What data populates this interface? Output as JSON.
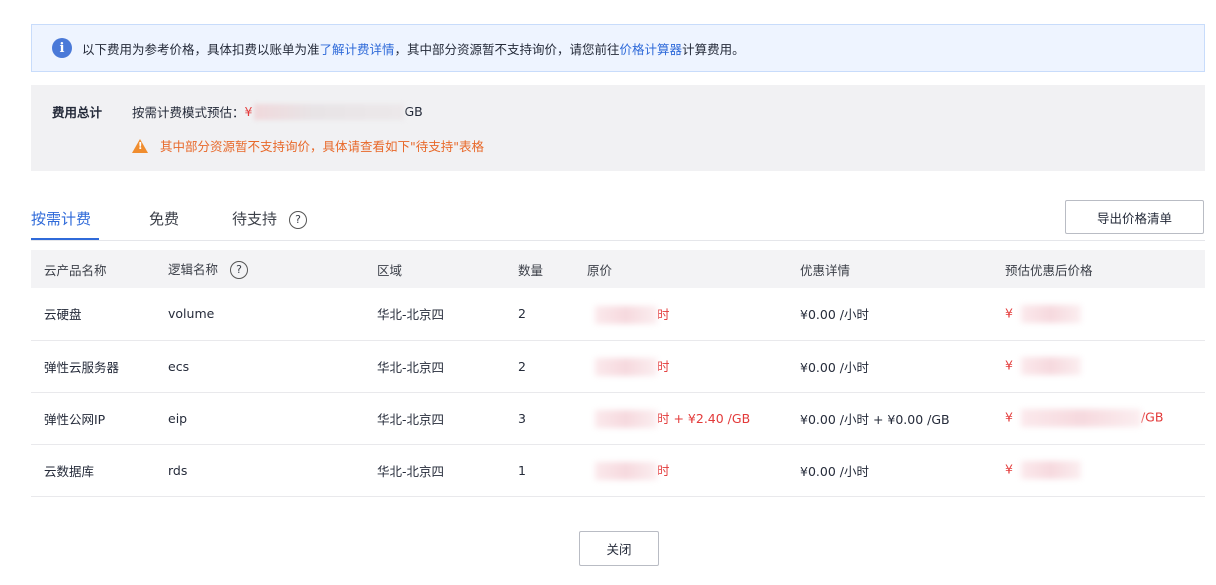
{
  "notice": {
    "text_prefix": "以下费用为参考价格，具体扣费以账单为准",
    "link_billing": "了解计费详情",
    "text_middle": "，其中部分资源暂不支持询价，请您前往",
    "link_calculator": "价格计算器",
    "text_suffix": "计算费用。"
  },
  "summary": {
    "label": "费用总计",
    "mode_label": "按需计费模式预估：",
    "currency": "¥",
    "unit_suffix": "GB",
    "warning": "其中部分资源暂不支持询价，具体请查看如下\"待支持\"表格"
  },
  "tabs": [
    {
      "label": "按需计费",
      "active": true
    },
    {
      "label": "免费",
      "active": false
    },
    {
      "label": "待支持",
      "active": false
    }
  ],
  "export_button": "导出价格清单",
  "table": {
    "headers": [
      "云产品名称",
      "逻辑名称",
      "区域",
      "数量",
      "原价",
      "优惠详情",
      "预估优惠后价格"
    ],
    "rows": [
      {
        "product": "云硬盘",
        "logical": "volume",
        "region": "华北-北京四",
        "qty": "2",
        "orig_suffix": "时",
        "discount": "¥0.00 /小时",
        "final_prefix": "¥",
        "final_suffix": ""
      },
      {
        "product": "弹性云服务器",
        "logical": "ecs",
        "region": "华北-北京四",
        "qty": "2",
        "orig_suffix": "时",
        "discount": "¥0.00 /小时",
        "final_prefix": "¥",
        "final_suffix": ""
      },
      {
        "product": "弹性公网IP",
        "logical": "eip",
        "region": "华北-北京四",
        "qty": "3",
        "orig_suffix": "时 + ¥2.40 /GB",
        "discount": "¥0.00 /小时 + ¥0.00 /GB",
        "final_prefix": "¥",
        "final_suffix": "/GB"
      },
      {
        "product": "云数据库",
        "logical": "rds",
        "region": "华北-北京四",
        "qty": "1",
        "orig_suffix": "时",
        "discount": "¥0.00 /小时",
        "final_prefix": "¥",
        "final_suffix": ""
      }
    ]
  },
  "close_button": "关闭",
  "colors": {
    "accent": "#2f6ad9",
    "price_red": "#e33a3a",
    "warning": "#e8692a"
  }
}
